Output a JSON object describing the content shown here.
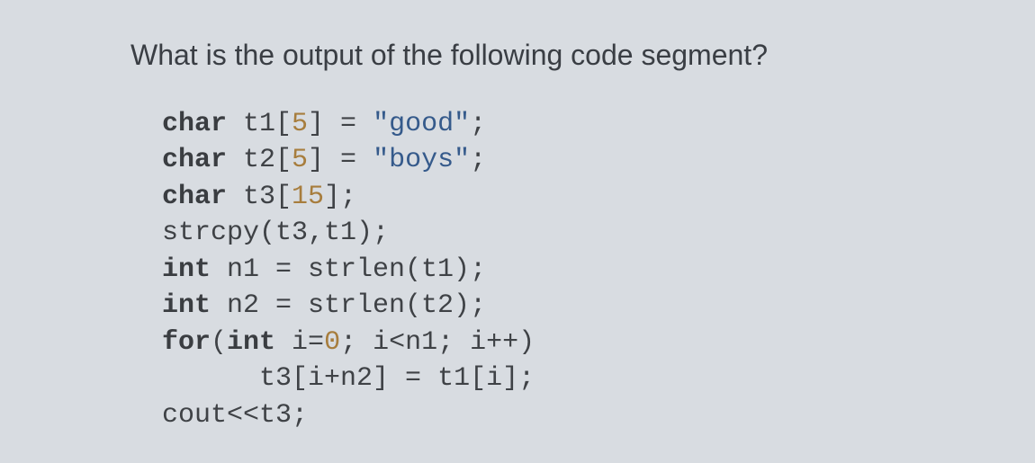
{
  "question": "What is the output of the following code segment?",
  "code": {
    "line1": {
      "kw": "char",
      "rest1": " t1[",
      "num1": "5",
      "rest2": "] = ",
      "str": "\"good\"",
      "end": ";"
    },
    "line2": {
      "kw": "char",
      "rest1": " t2[",
      "num1": "5",
      "rest2": "] = ",
      "str": "\"boys\"",
      "end": ";"
    },
    "line3": {
      "kw": "char",
      "rest1": " t3[",
      "num1": "15",
      "rest2": "];",
      "str": "",
      "end": ""
    },
    "line4": {
      "text": "strcpy(t3,t1);"
    },
    "line5": {
      "kw": "int",
      "rest": " n1 = strlen(t1);"
    },
    "line6": {
      "kw": "int",
      "rest": " n2 = strlen(t2);"
    },
    "line7": {
      "kw": "for",
      "rest1": "(",
      "kw2": "int",
      "rest2": " i=",
      "num1": "0",
      "rest3": "; i<n1; i++)"
    },
    "line8": {
      "indent": "      ",
      "text": "t3[i+n2] = t1[i];"
    },
    "line9": {
      "text": "cout<<t3;"
    }
  }
}
